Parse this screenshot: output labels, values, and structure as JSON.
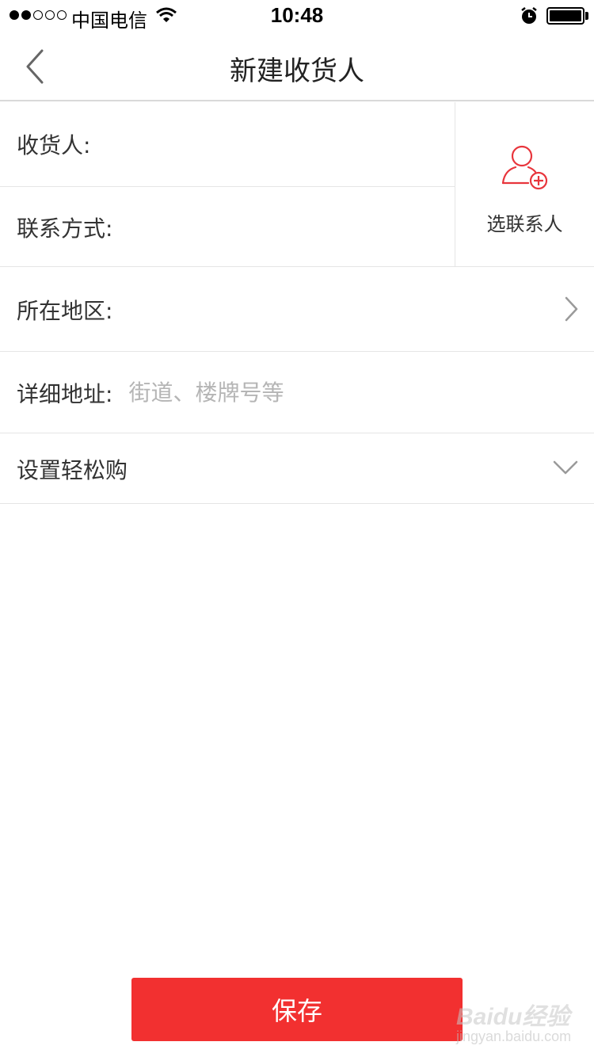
{
  "status_bar": {
    "carrier": "中国电信",
    "time": "10:48",
    "signal_filled": 2,
    "signal_total": 5
  },
  "nav": {
    "title": "新建收货人",
    "back_icon": "chevron-left-icon"
  },
  "form": {
    "recipient": {
      "label": "收货人:",
      "value": ""
    },
    "phone": {
      "label": "联系方式:",
      "value": ""
    },
    "pick_contact": {
      "label": "选联系人",
      "icon": "add-contact-icon"
    },
    "region": {
      "label": "所在地区:",
      "value": ""
    },
    "address": {
      "label": "详细地址:",
      "value": "",
      "placeholder": "街道、楼牌号等"
    },
    "easy_buy": {
      "label": "设置轻松购"
    }
  },
  "actions": {
    "save_label": "保存"
  },
  "watermark": {
    "brand": "Baidu经验",
    "url": "jingyan.baidu.com"
  },
  "colors": {
    "accent": "#f23030",
    "icon_red": "#e8353c",
    "divider": "#e5e5e5",
    "placeholder": "#b5b5b5"
  }
}
